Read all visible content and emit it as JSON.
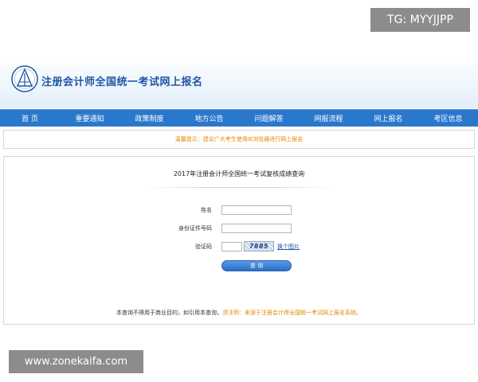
{
  "badge": {
    "text": "TG: MYYJJPP"
  },
  "header": {
    "title": "注册会计师全国统一考试网上报名"
  },
  "nav": {
    "items": [
      {
        "label": "首  页"
      },
      {
        "label": "重要通知"
      },
      {
        "label": "政策制度"
      },
      {
        "label": "地方公告"
      },
      {
        "label": "问题解答"
      },
      {
        "label": "网报流程"
      },
      {
        "label": "网上报名"
      },
      {
        "label": "考区信息"
      }
    ]
  },
  "notice": {
    "text": "温馨提示：建议广大考生使用IE浏览器进行网上报名"
  },
  "panel": {
    "title": "2017年注册会计师全国统一考试复核成绩查询",
    "form": {
      "name_label": "姓名",
      "name_value": "",
      "id_label": "身份证件号码",
      "id_value": "",
      "captcha_label": "验证码",
      "captcha_value": "",
      "captcha_text": "7885",
      "refresh_label": "换个图片",
      "submit_label": "查 询"
    }
  },
  "footer": {
    "main_text": "本查询不得用于商业目的，如引用本查询，",
    "source_text": "须注明：来源于注册会计师全国统一考试网上报名系统。"
  },
  "watermark": {
    "text": "www.zonekaifa.com"
  },
  "colors": {
    "accent": "#2a78cc",
    "title_blue": "#1f57a6",
    "notice_orange": "#e08a00"
  }
}
